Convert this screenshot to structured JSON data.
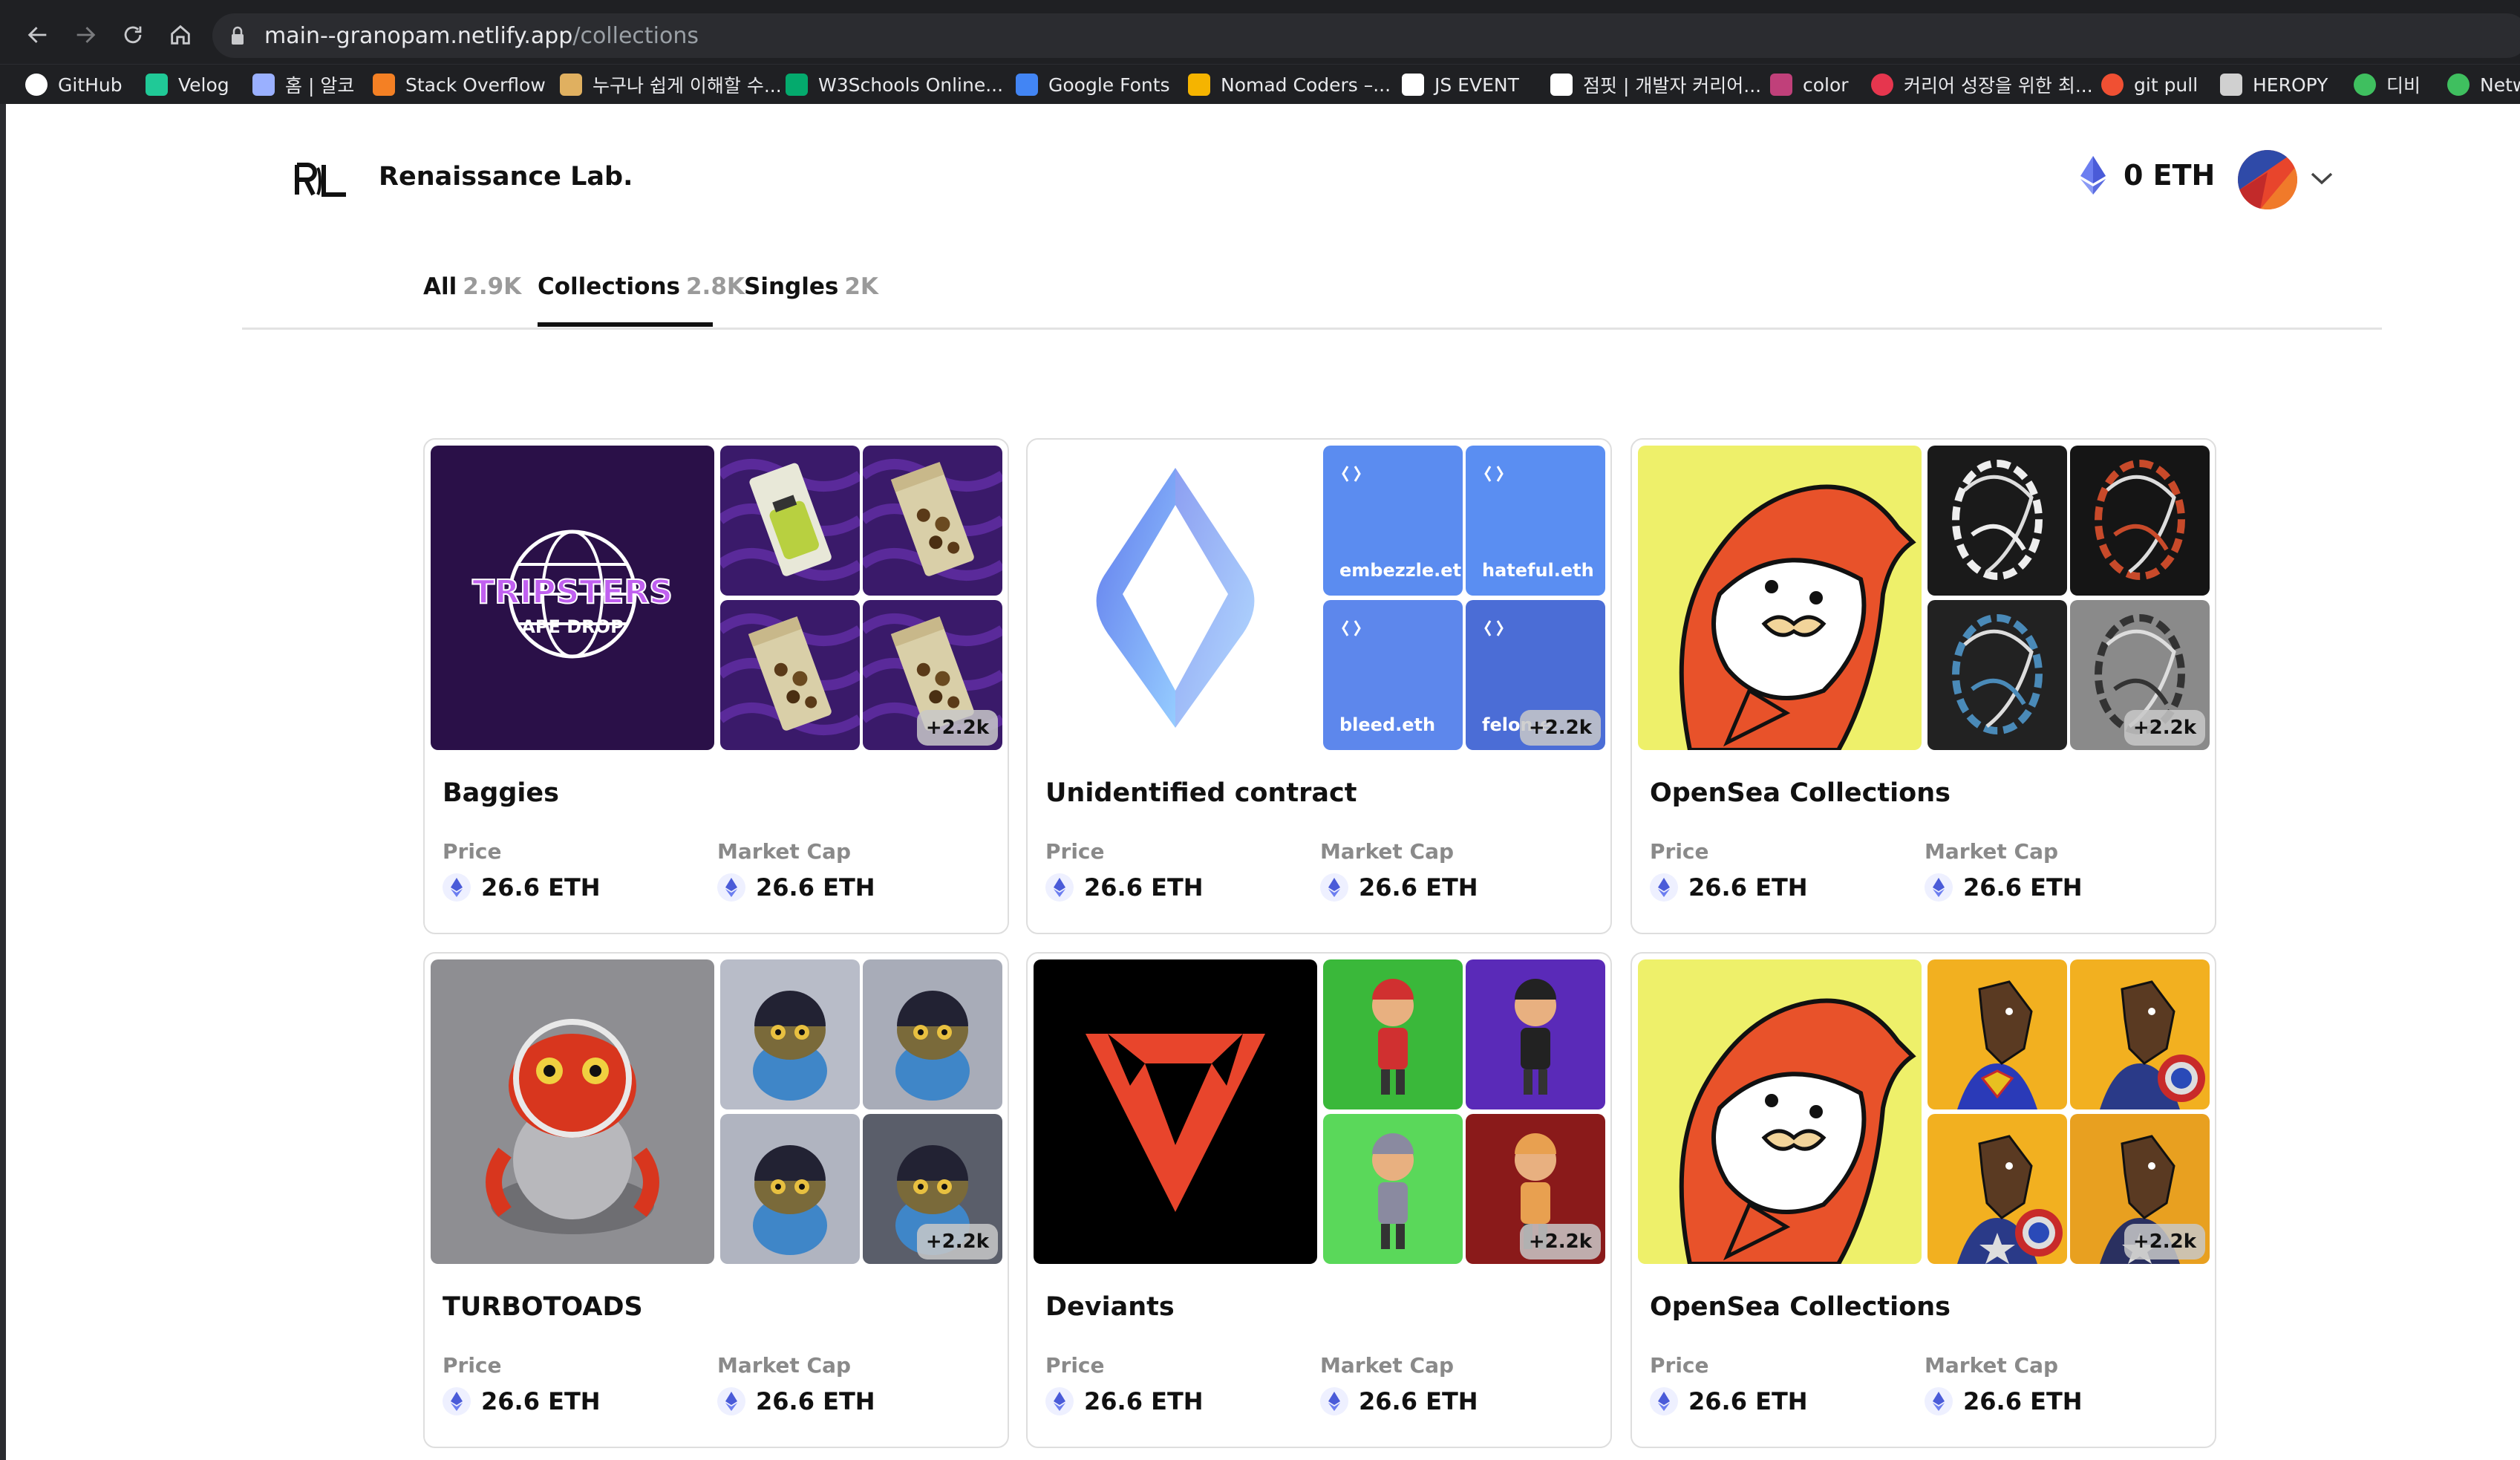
{
  "browser": {
    "url_host": "main--granopam.netlify.app",
    "url_path": "/collections",
    "bookmarks": [
      {
        "label": "GitHub",
        "icon": "github-icon",
        "color": "#ffffff"
      },
      {
        "label": "Velog",
        "icon": "velog-icon",
        "color": "#20c997"
      },
      {
        "label": "홈 | 알코",
        "icon": "code-braces-icon",
        "color": "#9ab0ff"
      },
      {
        "label": "Stack Overflow",
        "icon": "stackoverflow-icon",
        "color": "#f48024"
      },
      {
        "label": "누구나 쉽게 이해할 수...",
        "icon": "hand-icon",
        "color": "#e0b060"
      },
      {
        "label": "W3Schools Online...",
        "icon": "w3schools-icon",
        "color": "#04aa6d"
      },
      {
        "label": "Google Fonts",
        "icon": "google-fonts-icon",
        "color": "#4285f4"
      },
      {
        "label": "Nomad Coders –...",
        "icon": "nomad-icon",
        "color": "#f5b400"
      },
      {
        "label": "JS EVENT",
        "icon": "m-icon",
        "color": "#ffffff"
      },
      {
        "label": "점핏 | 개발자 커리어...",
        "icon": "jumpit-icon",
        "color": "#ffffff"
      },
      {
        "label": "color",
        "icon": "color-icon",
        "color": "#c0407a"
      },
      {
        "label": "커리어 성장을 위한 최...",
        "icon": "career-icon",
        "color": "#e6364e"
      },
      {
        "label": "git pull",
        "icon": "git-icon",
        "color": "#f05033"
      },
      {
        "label": "HEROPY",
        "icon": "heropy-icon",
        "color": "#d0d0d0"
      },
      {
        "label": "디비",
        "icon": "leaf-icon",
        "color": "#3fbf5f"
      },
      {
        "label": "Netw",
        "icon": "leaf-icon",
        "color": "#3fbf5f"
      }
    ]
  },
  "header": {
    "logo_text": "Renaissance Lab.",
    "balance": "0 ETH"
  },
  "tabs": [
    {
      "label": "All",
      "count": "2.9K"
    },
    {
      "label": "Collections",
      "count": "2.8K"
    },
    {
      "label": "Singles",
      "count": "2K"
    }
  ],
  "cards": [
    {
      "title": "Baggies",
      "price_label": "Price",
      "price": "26.6 ETH",
      "cap_label": "Market Cap",
      "cap": "26.6 ETH",
      "more": "+2.2k",
      "big_text_1": "TRIPSTERS",
      "big_text_2": "APE DROP"
    },
    {
      "title": "Unidentified contract",
      "price_label": "Price",
      "price": "26.6 ETH",
      "cap_label": "Market Cap",
      "cap": "26.6 ETH",
      "more": "+2.2k",
      "ens": [
        "embezzle.eth",
        "hateful.eth",
        "bleed.eth",
        "felon.e"
      ]
    },
    {
      "title": "OpenSea Collections",
      "price_label": "Price",
      "price": "26.6 ETH",
      "cap_label": "Market Cap",
      "cap": "26.6 ETH",
      "more": "+2.2k"
    },
    {
      "title": "TURBOTOADS",
      "price_label": "Price",
      "price": "26.6 ETH",
      "cap_label": "Market Cap",
      "cap": "26.6 ETH",
      "more": "+2.2k"
    },
    {
      "title": "Deviants",
      "price_label": "Price",
      "price": "26.6 ETH",
      "cap_label": "Market Cap",
      "cap": "26.6 ETH",
      "more": "+2.2k"
    },
    {
      "title": "OpenSea Collections",
      "price_label": "Price",
      "price": "26.6 ETH",
      "cap_label": "Market Cap",
      "cap": "26.6 ETH",
      "more": "+2.2k"
    }
  ]
}
